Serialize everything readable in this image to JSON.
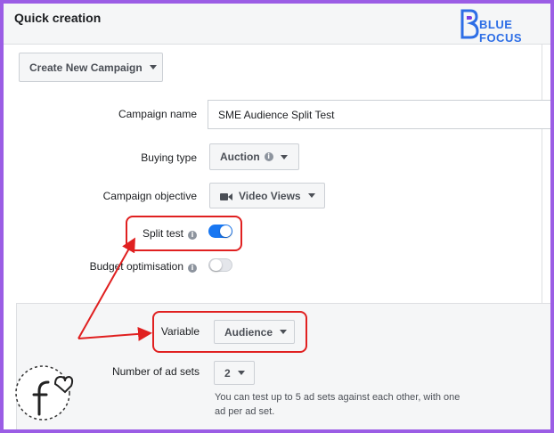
{
  "header": {
    "title": "Quick creation"
  },
  "logo": {
    "text": "BLUE FOCUS",
    "mark": "B-stylized-icon"
  },
  "campaign_selector": {
    "label": "Create New Campaign"
  },
  "form": {
    "campaign_name": {
      "label": "Campaign name",
      "value": "SME Audience Split Test"
    },
    "buying_type": {
      "label": "Buying type",
      "value": "Auction"
    },
    "campaign_objective": {
      "label": "Campaign objective",
      "value": "Video Views",
      "icon": "video-camera-icon"
    },
    "split_test": {
      "label": "Split test",
      "enabled": true
    },
    "budget_optimisation": {
      "label": "Budget optimisation",
      "enabled": false
    }
  },
  "split_test_options": {
    "variable": {
      "label": "Variable",
      "value": "Audience"
    },
    "ad_sets": {
      "label": "Number of ad sets",
      "value": "2"
    },
    "help_text": "You can test up to 5 ad sets against each other, with one ad per ad set."
  },
  "colors": {
    "frame": "#9b5de5",
    "accent": "#1877f2",
    "highlight": "#e02020",
    "logo": "#2d6ee6"
  }
}
